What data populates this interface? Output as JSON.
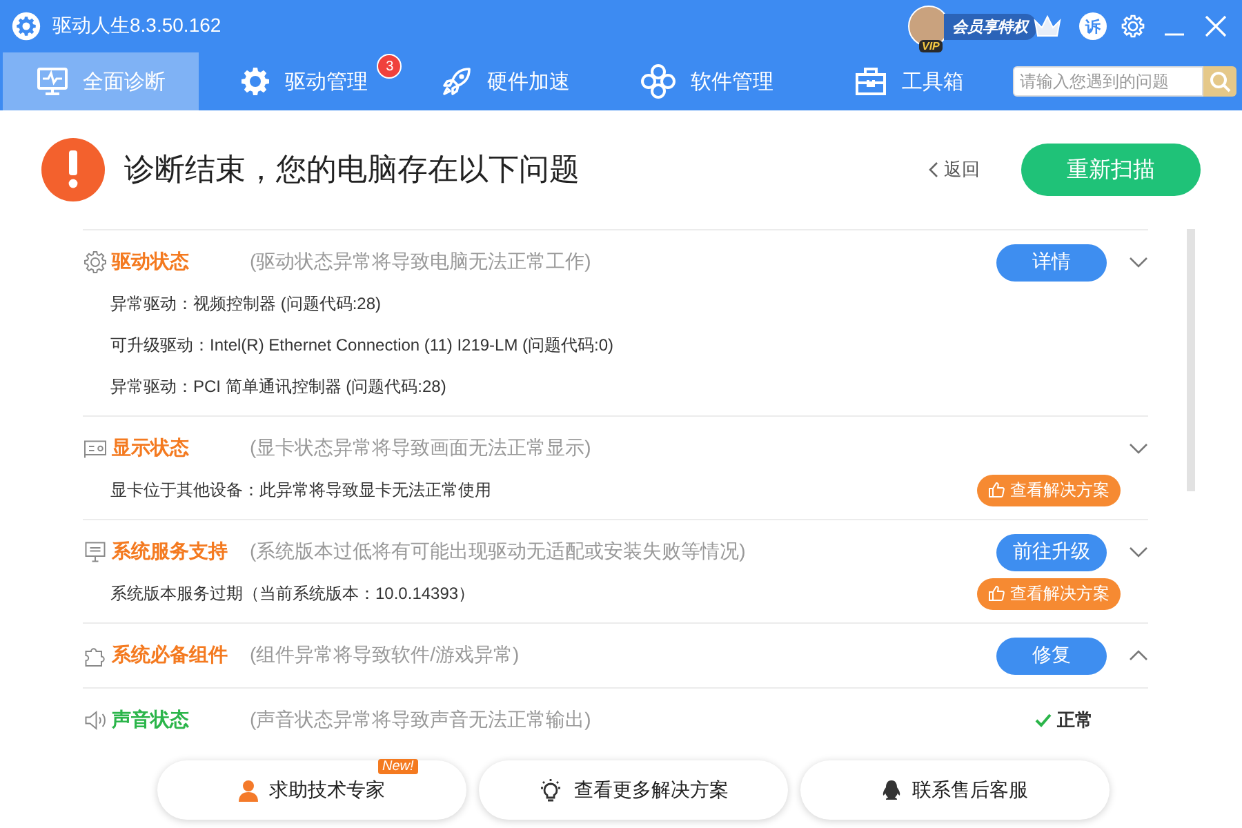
{
  "window": {
    "title": "驱动人生8.3.50.162",
    "vip_label": "会员享特权",
    "vip_badge": "VIP",
    "complaint_icon_text": "诉"
  },
  "tabs": [
    {
      "label": "全面诊断",
      "selected": true
    },
    {
      "label": "驱动管理",
      "selected": false,
      "badge": "3"
    },
    {
      "label": "硬件加速",
      "selected": false
    },
    {
      "label": "软件管理",
      "selected": false
    },
    {
      "label": "工具箱",
      "selected": false
    }
  ],
  "search": {
    "placeholder": "请输入您遇到的问题"
  },
  "header": {
    "title": "诊断结束，您的电脑存在以下问题",
    "back": "返回",
    "rescan": "重新扫描"
  },
  "sections": [
    {
      "title": "驱动状态",
      "ok": false,
      "description": "(驱动状态异常将导致电脑无法正常工作)",
      "action": "详情",
      "expanded": false,
      "items": [
        {
          "text": "异常驱动：视频控制器 (问题代码:28)"
        },
        {
          "text": "可升级驱动：Intel(R) Ethernet Connection (11) I219-LM (问题代码:0)"
        },
        {
          "text": "异常驱动：PCI 简单通讯控制器 (问题代码:28)"
        }
      ]
    },
    {
      "title": "显示状态",
      "ok": false,
      "description": "(显卡状态异常将导致画面无法正常显示)",
      "expanded": false,
      "items": [
        {
          "text": "显卡位于其他设备：此异常将导致显卡无法正常使用",
          "solution": "查看解决方案"
        }
      ]
    },
    {
      "title": "系统服务支持",
      "ok": false,
      "description": "(系统版本过低将有可能出现驱动无适配或安装失败等情况)",
      "action": "前往升级",
      "expanded": false,
      "items": [
        {
          "text": "系统版本服务过期（当前系统版本：10.0.14393）",
          "solution": "查看解决方案"
        }
      ]
    },
    {
      "title": "系统必备组件",
      "ok": false,
      "description": "(组件异常将导致软件/游戏异常)",
      "action": "修复",
      "expanded": true
    },
    {
      "title": "声音状态",
      "ok": true,
      "description": "(声音状态异常将导致声音无法正常输出)",
      "status_label": "正常"
    }
  ],
  "footer_buttons": [
    {
      "label": "求助技术专家",
      "badge": "New!"
    },
    {
      "label": "查看更多解决方案"
    },
    {
      "label": "联系售后客服"
    }
  ]
}
